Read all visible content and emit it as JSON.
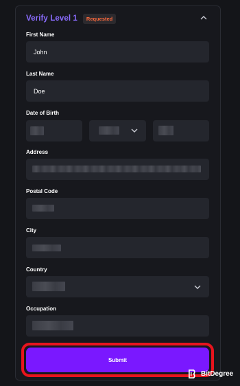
{
  "header": {
    "title": "Verify Level 1",
    "badge": "Requested"
  },
  "form": {
    "first_name": {
      "label": "First Name",
      "value": "John"
    },
    "last_name": {
      "label": "Last Name",
      "value": "Doe"
    },
    "date_of_birth": {
      "label": "Date of Birth"
    },
    "address": {
      "label": "Address"
    },
    "postal_code": {
      "label": "Postal Code"
    },
    "city": {
      "label": "City"
    },
    "country": {
      "label": "Country"
    },
    "occupation": {
      "label": "Occupation"
    }
  },
  "actions": {
    "submit_label": "Submit"
  },
  "watermark": {
    "brand": "BitDegree"
  },
  "colors": {
    "accent": "#7a18ff",
    "title": "#8b6cff",
    "badge_text": "#ff6a3d",
    "highlight_outline": "#e8141d"
  },
  "icons": {
    "collapse": "chevron-up-icon",
    "dropdown": "chevron-down-icon",
    "brand": "bitdegree-logo-icon"
  }
}
